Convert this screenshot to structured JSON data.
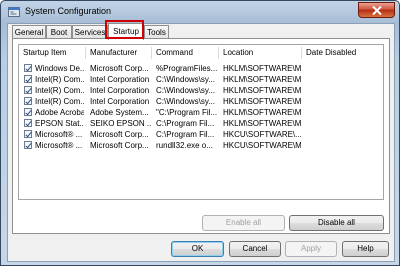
{
  "window": {
    "title": "System Configuration"
  },
  "tabs": [
    {
      "label": "General"
    },
    {
      "label": "Boot"
    },
    {
      "label": "Services"
    },
    {
      "label": "Startup"
    },
    {
      "label": "Tools"
    }
  ],
  "active_tab": "Startup",
  "columns": {
    "item": "Startup Item",
    "manufacturer": "Manufacturer",
    "command": "Command",
    "location": "Location",
    "date_disabled": "Date Disabled"
  },
  "rows": [
    {
      "checked": true,
      "item": "Windows De...",
      "manufacturer": "Microsoft Corp...",
      "command": "%ProgramFiles...",
      "location": "HKLM\\SOFTWARE\\M..."
    },
    {
      "checked": true,
      "item": "Intel(R) Com...",
      "manufacturer": "Intel Corporation",
      "command": "C:\\Windows\\sy...",
      "location": "HKLM\\SOFTWARE\\M..."
    },
    {
      "checked": true,
      "item": "Intel(R) Com...",
      "manufacturer": "Intel Corporation",
      "command": "C:\\Windows\\sy...",
      "location": "HKLM\\SOFTWARE\\M..."
    },
    {
      "checked": true,
      "item": "Intel(R) Com...",
      "manufacturer": "Intel Corporation",
      "command": "C:\\Windows\\sy...",
      "location": "HKLM\\SOFTWARE\\M..."
    },
    {
      "checked": true,
      "item": "Adobe Acrobat",
      "manufacturer": "Adobe System...",
      "command": "\"C:\\Program Fil...",
      "location": "HKLM\\SOFTWARE\\M..."
    },
    {
      "checked": true,
      "item": "EPSON Stat...",
      "manufacturer": "SEIKO EPSON ...",
      "command": "C:\\Program Fil...",
      "location": "HKLM\\SOFTWARE\\M..."
    },
    {
      "checked": true,
      "item": "Microsoft® ...",
      "manufacturer": "Microsoft Corp...",
      "command": "C:\\Program Fil...",
      "location": "HKCU\\SOFTWARE\\..."
    },
    {
      "checked": true,
      "item": "Microsoft® ...",
      "manufacturer": "Microsoft Corp...",
      "command": "rundll32.exe o...",
      "location": "HKCU\\SOFTWARE\\M..."
    }
  ],
  "panel_buttons": {
    "enable_all": "Enable all",
    "disable_all": "Disable all"
  },
  "footer_buttons": {
    "ok": "OK",
    "cancel": "Cancel",
    "apply": "Apply",
    "help": "Help"
  },
  "colors": {
    "highlight": "#d00000",
    "title_bar": "#a7bdd6",
    "close_button": "#c9452a"
  }
}
